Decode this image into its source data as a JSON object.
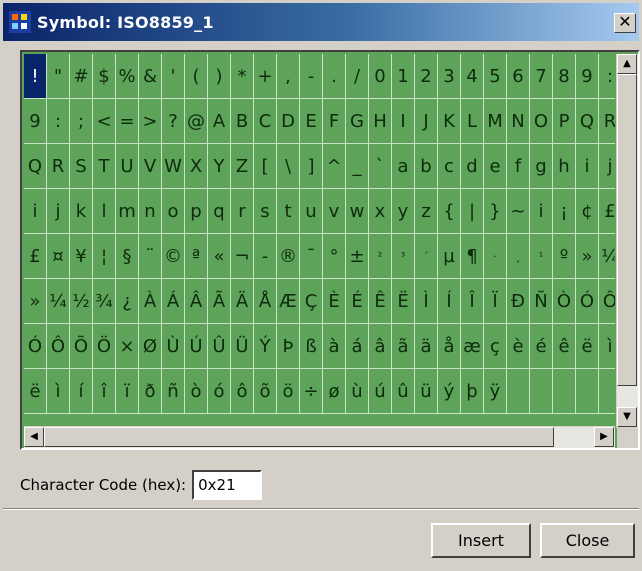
{
  "window": {
    "title": "Symbol: ISO8859_1",
    "close_glyph": "✕"
  },
  "grid": {
    "rows": [
      [
        "!",
        "\"",
        "#",
        "$",
        "%",
        "&",
        "'",
        "(",
        ")",
        "*",
        "+",
        ",",
        "-",
        ".",
        "/",
        "0",
        "1",
        "2",
        "3",
        "4",
        "5",
        "6",
        "7",
        "8",
        "9",
        ":"
      ],
      [
        "9",
        ":",
        ";",
        "<",
        "=",
        ">",
        "?",
        "@",
        "A",
        "B",
        "C",
        "D",
        "E",
        "F",
        "G",
        "H",
        "I",
        "J",
        "K",
        "L",
        "M",
        "N",
        "O",
        "P",
        "Q",
        "R"
      ],
      [
        "Q",
        "R",
        "S",
        "T",
        "U",
        "V",
        "W",
        "X",
        "Y",
        "Z",
        "[",
        "\\",
        "]",
        "^",
        "_",
        "`",
        "a",
        "b",
        "c",
        "d",
        "e",
        "f",
        "g",
        "h",
        "i",
        "j"
      ],
      [
        "i",
        "j",
        "k",
        "l",
        "m",
        "n",
        "o",
        "p",
        "q",
        "r",
        "s",
        "t",
        "u",
        "v",
        "w",
        "x",
        "y",
        "z",
        "{",
        "|",
        "}",
        "~",
        "i",
        "¡",
        "¢",
        "£"
      ],
      [
        "£",
        "¤",
        "¥",
        "¦",
        "§",
        "¨",
        "©",
        "ª",
        "«",
        "¬",
        "-",
        "®",
        "¯",
        "°",
        "±",
        "²",
        "³",
        "´",
        "µ",
        "¶",
        "·",
        "¸",
        "¹",
        "º",
        "»",
        "¼"
      ],
      [
        "»",
        "¼",
        "½",
        "¾",
        "¿",
        "À",
        "Á",
        "Â",
        "Ã",
        "Ä",
        "Å",
        "Æ",
        "Ç",
        "È",
        "É",
        "Ê",
        "Ë",
        "Ì",
        "Í",
        "Î",
        "Ï",
        "Ð",
        "Ñ",
        "Ò",
        "Ó",
        "Ô"
      ],
      [
        "Ó",
        "Ô",
        "Õ",
        "Ö",
        "×",
        "Ø",
        "Ù",
        "Ú",
        "Û",
        "Ü",
        "Ý",
        "Þ",
        "ß",
        "à",
        "á",
        "â",
        "ã",
        "ä",
        "å",
        "æ",
        "ç",
        "è",
        "é",
        "ê",
        "ë",
        "ì"
      ],
      [
        "ë",
        "ì",
        "í",
        "î",
        "ï",
        "ð",
        "ñ",
        "ò",
        "ó",
        "ô",
        "õ",
        "ö",
        "÷",
        "ø",
        "ù",
        "ú",
        "û",
        "ü",
        "ý",
        "þ",
        "ÿ",
        "",
        "",
        "",
        "",
        ""
      ]
    ],
    "selected": "!",
    "small_glyphs": [
      "²",
      "³",
      "¹",
      "´",
      "·",
      "¸"
    ]
  },
  "scroll": {
    "up_glyph": "▲",
    "down_glyph": "▼",
    "left_glyph": "◀",
    "right_glyph": "▶"
  },
  "form": {
    "code_label": "Character Code (hex):",
    "code_value": "0x21"
  },
  "buttons": {
    "insert_label": "Insert",
    "close_label": "Close"
  },
  "colors": {
    "grid_bg": "#5ea35a",
    "grid_line": "#c8e3c6",
    "selection": "#0a246a"
  }
}
